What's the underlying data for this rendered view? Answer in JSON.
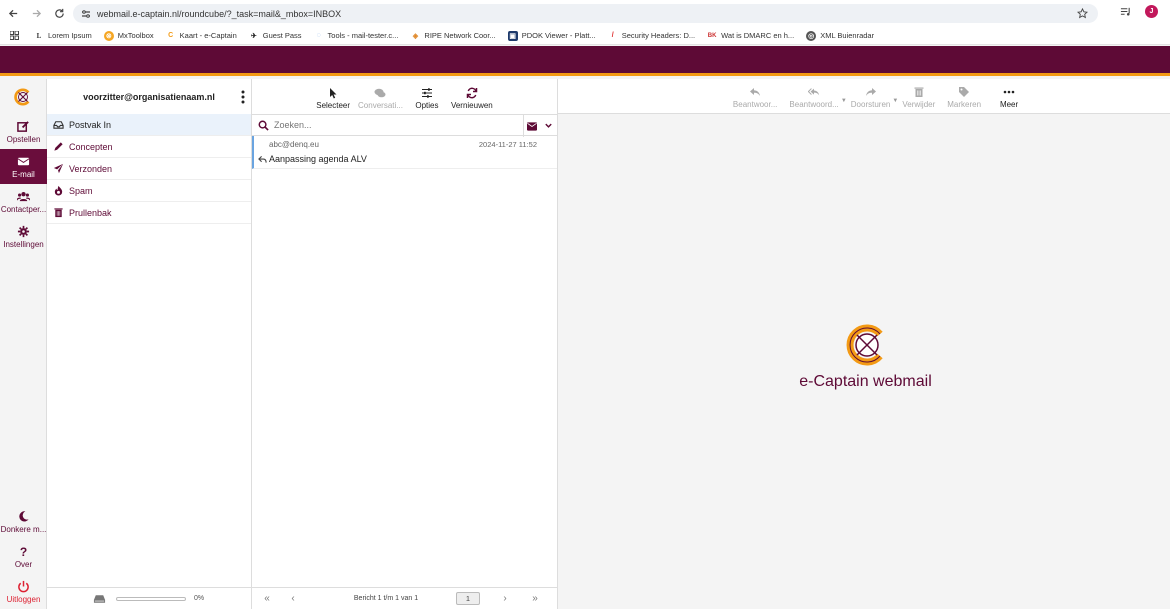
{
  "browser": {
    "url": "webmail.e-captain.nl/roundcube/?_task=mail&_mbox=INBOX",
    "profile_initial": "J",
    "bookmarks": [
      {
        "label": "Lorem Ipsum",
        "icon": "lorem-icon"
      },
      {
        "label": "MxToolbox",
        "icon": "mxtoolbox-icon"
      },
      {
        "label": "Kaart - e-Captain",
        "icon": "ecaptain-icon"
      },
      {
        "label": "Guest Pass",
        "icon": "guest-pass-icon"
      },
      {
        "label": "Tools - mail-tester.c...",
        "icon": "mail-tester-icon"
      },
      {
        "label": "RIPE Network Coor...",
        "icon": "ripe-icon"
      },
      {
        "label": "PDOK Viewer - Platt...",
        "icon": "pdok-icon"
      },
      {
        "label": "Security Headers: D...",
        "icon": "security-headers-icon"
      },
      {
        "label": "Wat is DMARC en h...",
        "icon": "dmarc-icon"
      },
      {
        "label": "XML Buienradar",
        "icon": "buienradar-icon"
      }
    ]
  },
  "rail": {
    "items": [
      {
        "label": "Opstellen",
        "icon": "compose-icon"
      },
      {
        "label": "E-mail",
        "icon": "envelope-icon"
      },
      {
        "label": "Contactper...",
        "icon": "contacts-icon"
      },
      {
        "label": "Instellingen",
        "icon": "gear-icon"
      }
    ],
    "bottom": [
      {
        "label": "Donkere m...",
        "icon": "moon-icon"
      },
      {
        "label": "Over",
        "icon": "question-icon"
      },
      {
        "label": "Uitloggen",
        "icon": "power-icon"
      }
    ]
  },
  "folders": {
    "account": "voorzitter@organisatienaam.nl",
    "items": [
      {
        "label": "Postvak In",
        "icon": "inbox-icon"
      },
      {
        "label": "Concepten",
        "icon": "pencil-icon"
      },
      {
        "label": "Verzonden",
        "icon": "paper-plane-icon"
      },
      {
        "label": "Spam",
        "icon": "fire-icon"
      },
      {
        "label": "Prullenbak",
        "icon": "trash-icon"
      }
    ],
    "quota": {
      "text": "0%",
      "fraction": 0
    }
  },
  "list": {
    "toolbar": {
      "select": "Selecteer",
      "threads": "Conversati...",
      "options": "Opties",
      "refresh": "Vernieuwen"
    },
    "search_placeholder": "Zoeken...",
    "messages": [
      {
        "from": "abc@denq.eu",
        "date": "2024-11-27 11:52",
        "subject": "Aanpassing agenda ALV"
      }
    ],
    "pager": {
      "text": "Bericht 1 t/m 1 van 1",
      "page": "1"
    }
  },
  "preview": {
    "toolbar": {
      "reply": "Beantwoor...",
      "reply_all": "Beantwoord...",
      "forward": "Doorsturen",
      "delete": "Verwijder",
      "mark": "Markeren",
      "more": "Meer"
    },
    "brand_text": "e-Captain webmail"
  },
  "colors": {
    "brand": "#5e0a36",
    "accent": "#f39a14",
    "selected_folder_bg": "#eaf2fb"
  }
}
